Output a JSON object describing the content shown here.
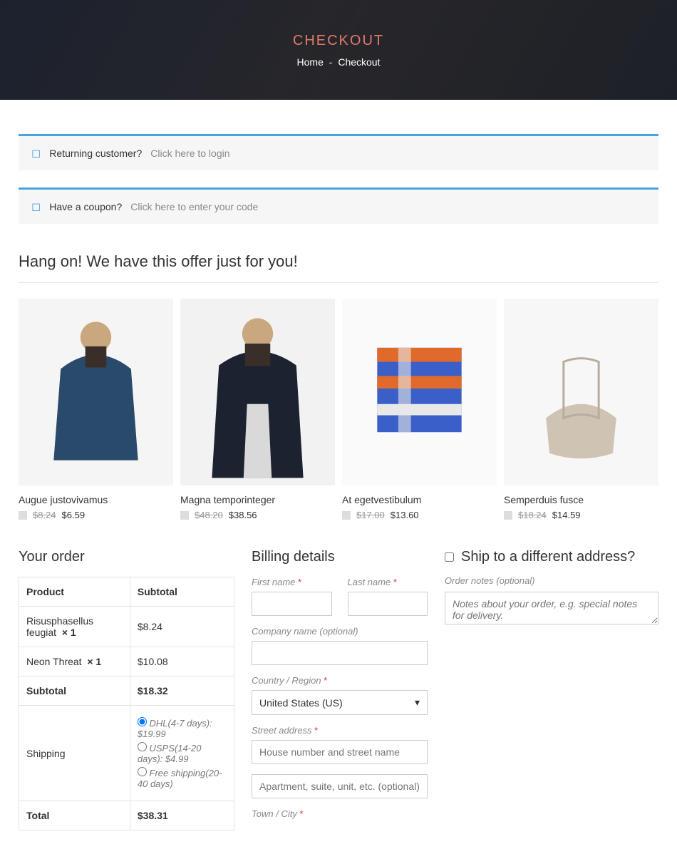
{
  "hero": {
    "title": "CHECKOUT",
    "breadcrumb_home": "Home",
    "breadcrumb_sep": "-",
    "breadcrumb_current": "Checkout"
  },
  "notices": {
    "returning_label": "Returning customer?",
    "returning_link": "Click here to login",
    "coupon_label": "Have a coupon?",
    "coupon_link": "Click here to enter your code"
  },
  "offer_title": "Hang on! We have this offer just for you!",
  "products": [
    {
      "name": "Augue justovivamus",
      "old": "$8.24",
      "new": "$6.59"
    },
    {
      "name": "Magna temporinteger",
      "old": "$48.20",
      "new": "$38.56"
    },
    {
      "name": "At egetvestibulum",
      "old": "$17.00",
      "new": "$13.60"
    },
    {
      "name": "Semperduis fusce",
      "old": "$18.24",
      "new": "$14.59"
    }
  ],
  "order": {
    "title": "Your order",
    "col_product": "Product",
    "col_subtotal": "Subtotal",
    "items": [
      {
        "name": "Risusphasellus feugiat",
        "qty": "× 1",
        "price": "$8.24"
      },
      {
        "name": "Neon Threat",
        "qty": "× 1",
        "price": "$10.08"
      }
    ],
    "subtotal_label": "Subtotal",
    "subtotal_value": "$18.32",
    "shipping_label": "Shipping",
    "shipping_options": [
      {
        "label": "DHL(4-7 days): $19.99",
        "checked": true
      },
      {
        "label": "USPS(14-20 days): $4.99",
        "checked": false
      },
      {
        "label": "Free shipping(20-40 days)",
        "checked": false
      }
    ],
    "total_label": "Total",
    "total_value": "$38.31"
  },
  "billing": {
    "title": "Billing details",
    "first_name": "First name",
    "last_name": "Last name",
    "company": "Company name (optional)",
    "country": "Country / Region",
    "country_value": "United States (US)",
    "street": "Street address",
    "street_ph1": "House number and street name",
    "street_ph2": "Apartment, suite, unit, etc. (optional)",
    "town": "Town / City"
  },
  "ship": {
    "title": "Ship to a different address?",
    "notes_label": "Order notes (optional)",
    "notes_ph": "Notes about your order, e.g. special notes for delivery."
  }
}
